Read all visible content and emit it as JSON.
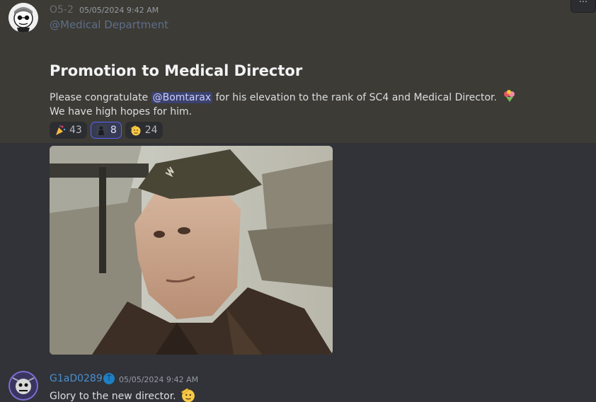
{
  "message1": {
    "author": "O5-2",
    "timestamp": "05/05/2024 9:42 AM",
    "role_mention": "@Medical Department",
    "heading": "Promotion to Medical Director",
    "text_before": "Please congratulate ",
    "user_mention": "@Bomtarax",
    "text_after": " for his elevation to the rank of SC4 and Medical Director.",
    "line2": "We have high hopes for him.",
    "reactions": [
      {
        "emoji": "party-popper",
        "count": "43",
        "active": false
      },
      {
        "emoji": "custom-figure",
        "count": "8",
        "active": true
      },
      {
        "emoji": "saluting-face",
        "count": "24",
        "active": false
      }
    ],
    "gif": {
      "alt": "soldier in military uniform gif"
    }
  },
  "message2": {
    "author": "G1aD0289",
    "timestamp": "05/05/2024 9:42 AM",
    "role_icon": "role-shield-icon",
    "text": "Glory to the new director."
  },
  "toolbar": {
    "more_label": "···"
  },
  "colors": {
    "background": "#313338",
    "highlight": "#3d3b35",
    "mention_bg": "#3c4270",
    "author2": "#4a8fd1",
    "active_reaction_border": "#5865f2"
  }
}
